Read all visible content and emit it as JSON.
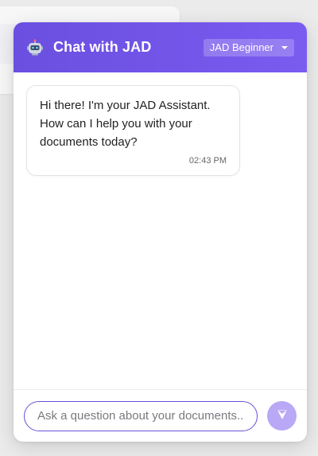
{
  "header": {
    "bot_icon": "robot-icon",
    "title": "Chat with JAD",
    "level_select": {
      "selected": "JAD Beginner"
    },
    "accent_color": "#6a4fe0"
  },
  "messages": [
    {
      "sender": "assistant",
      "text": "Hi there! I'm your JAD Assistant. How can I help you with your documents today?",
      "time": "02:43 PM"
    }
  ],
  "composer": {
    "placeholder": "Ask a question about your documents...",
    "value": "",
    "send_icon": "send-icon"
  }
}
